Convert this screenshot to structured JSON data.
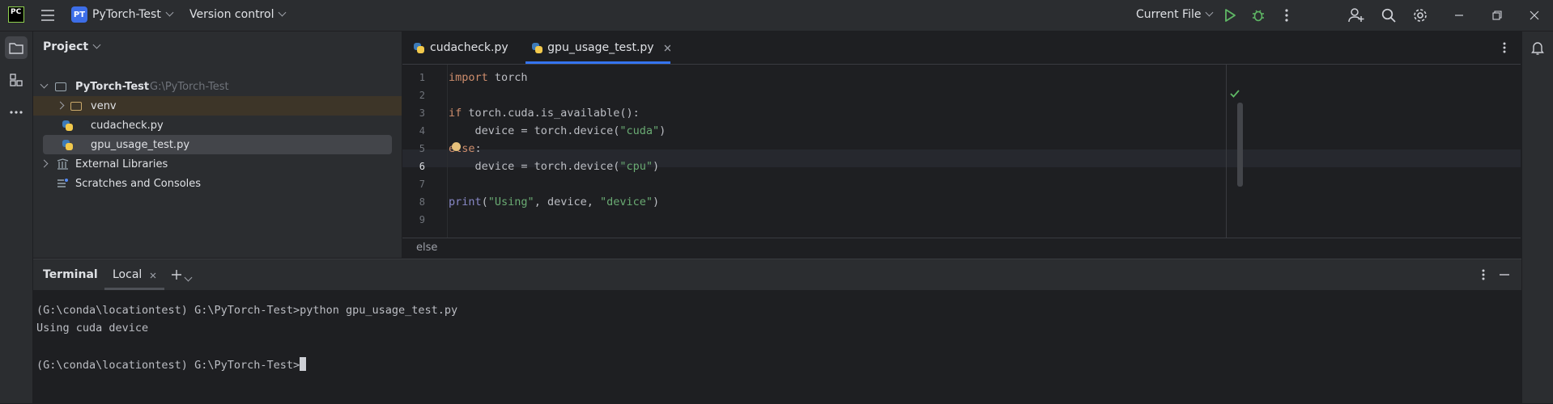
{
  "titlebar": {
    "app_logo": "PC",
    "project_badge": "PT",
    "project_name": "PyTorch-Test",
    "vcs": "Version control",
    "run_config": "Current File",
    "icons": [
      "main-menu-icon",
      "run-icon",
      "debug-icon",
      "more-icon",
      "add-user-icon",
      "search-icon",
      "settings-icon",
      "minimize-icon",
      "restore-icon",
      "close-icon"
    ]
  },
  "project_panel": {
    "title": "Project",
    "tree": [
      {
        "label": "PyTorch-Test",
        "hint": "G:\\PyTorch-Test"
      },
      {
        "label": "venv"
      },
      {
        "label": "cudacheck.py"
      },
      {
        "label": "gpu_usage_test.py"
      },
      {
        "label": "External Libraries"
      },
      {
        "label": "Scratches and Consoles"
      }
    ]
  },
  "editor": {
    "tabs": [
      {
        "label": "cudacheck.py"
      },
      {
        "label": "gpu_usage_test.py"
      }
    ],
    "line_numbers": [
      "1",
      "2",
      "3",
      "4",
      "5",
      "6",
      "7",
      "8",
      "9"
    ],
    "code": {
      "l1_kw": "import",
      "l1_rest": " torch",
      "l3_kw": "if",
      "l3_rest": " torch.cuda.is_available():",
      "l4_a": "    device = torch.device(",
      "l4_str": "\"cuda\"",
      "l4_b": ")",
      "l5_kw": "else",
      "l5_rest": ":",
      "l6_a": "    device = torch.device(",
      "l6_str": "\"cpu\"",
      "l6_b": ")",
      "l8_fn": "print",
      "l8_a": "(",
      "l8_s1": "\"Using\"",
      "l8_b": ", device, ",
      "l8_s2": "\"device\"",
      "l8_c": ")"
    },
    "breadcrumb": "else",
    "colors": {
      "keyword": "#cf8e6d",
      "string": "#6aab73",
      "accent": "#3574f0"
    }
  },
  "terminal": {
    "title": "Terminal",
    "tab": "Local",
    "lines": [
      "(G:\\conda\\locationtest) G:\\PyTorch-Test>python gpu_usage_test.py",
      "Using cuda device",
      "(G:\\conda\\locationtest) G:\\PyTorch-Test>"
    ]
  }
}
